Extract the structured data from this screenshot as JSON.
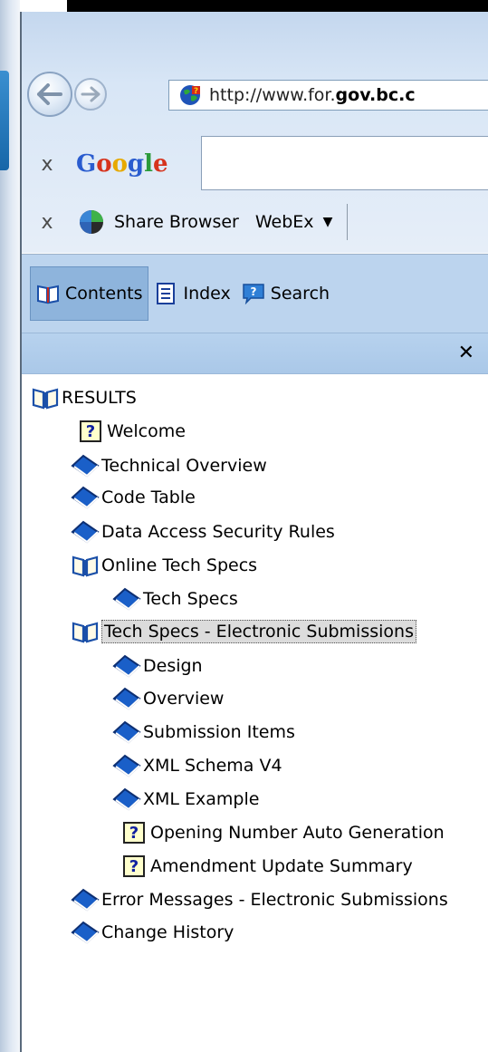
{
  "browser": {
    "url_prefix": "http://www.for.",
    "url_domain": "gov.bc.c",
    "google_toolbar": {
      "close": "x",
      "logo": "Google",
      "search_value": ""
    },
    "share_toolbar": {
      "close": "x",
      "share_label": "Share Browser",
      "webex_label": "WebEx",
      "webex_arrow": "▼"
    }
  },
  "help_pane": {
    "tabs": [
      {
        "label": "Contents",
        "icon": "book-icon",
        "active": true
      },
      {
        "label": "Index",
        "icon": "index-icon",
        "active": false
      },
      {
        "label": "Search",
        "icon": "search-bubble-icon",
        "active": false
      }
    ],
    "close_label": "✕",
    "tree": [
      {
        "label": "RESULTS",
        "icon": "open-book-icon"
      },
      {
        "label": "Welcome",
        "icon": "help-page-icon"
      },
      {
        "label": "Technical Overview",
        "icon": "closed-book-icon"
      },
      {
        "label": "Code Table",
        "icon": "closed-book-icon"
      },
      {
        "label": "Data Access Security Rules",
        "icon": "closed-book-icon"
      },
      {
        "label": "Online Tech Specs",
        "icon": "open-book-icon"
      },
      {
        "label": "Tech Specs",
        "icon": "closed-book-icon"
      },
      {
        "label": "Tech Specs - Electronic Submissions",
        "icon": "open-book-icon",
        "selected": true
      },
      {
        "label": "Design",
        "icon": "closed-book-icon"
      },
      {
        "label": "Overview",
        "icon": "closed-book-icon"
      },
      {
        "label": "Submission Items",
        "icon": "closed-book-icon"
      },
      {
        "label": "XML Schema V4",
        "icon": "closed-book-icon"
      },
      {
        "label": "XML Example",
        "icon": "closed-book-icon"
      },
      {
        "label": "Opening Number Auto Generation",
        "icon": "help-page-icon"
      },
      {
        "label": "Amendment Update Summary",
        "icon": "help-page-icon"
      },
      {
        "label": "Error Messages - Electronic Submissions",
        "icon": "closed-book-icon"
      },
      {
        "label": "Change History",
        "icon": "closed-book-icon"
      }
    ]
  },
  "colors": {
    "pane_bar": "#bcd4ee",
    "tab_active": "#8eb4dc",
    "book_blue": "#1a5fc8"
  }
}
